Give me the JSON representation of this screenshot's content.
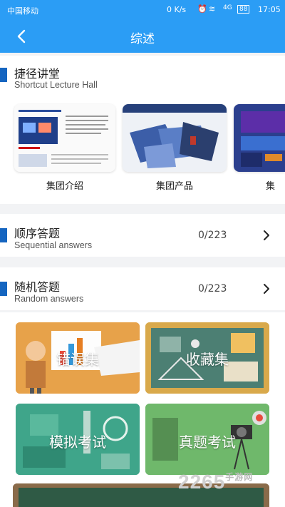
{
  "status_bar": {
    "carrier": "中国移动",
    "network_speed": "0 K/s",
    "signal": "4G",
    "battery": "88",
    "time": "17:05"
  },
  "header": {
    "title": "综述",
    "back_icon": "chevron-left-icon"
  },
  "lecture_hall": {
    "title": "捷径讲堂",
    "subtitle": "Shortcut Lecture Hall",
    "items": [
      {
        "label": "集团介绍"
      },
      {
        "label": "集团产品"
      },
      {
        "label": "集"
      }
    ]
  },
  "sequential": {
    "title": "顺序答题",
    "subtitle": "Sequential answers",
    "count": "0/223"
  },
  "random": {
    "title": "随机答题",
    "subtitle": "Random answers",
    "count": "0/223"
  },
  "tiles": [
    {
      "label": "错误集",
      "color": "#e7a24a"
    },
    {
      "label": "收藏集",
      "color": "#d9a94b"
    },
    {
      "label": "模拟考试",
      "color": "#3fa58a"
    },
    {
      "label": "真题考试",
      "color": "#6fb86b"
    }
  ],
  "watermark": {
    "brand": "2265",
    "sub": "手游网"
  },
  "colors": {
    "primary": "#2b9df5",
    "accent_bar": "#1565c0"
  }
}
